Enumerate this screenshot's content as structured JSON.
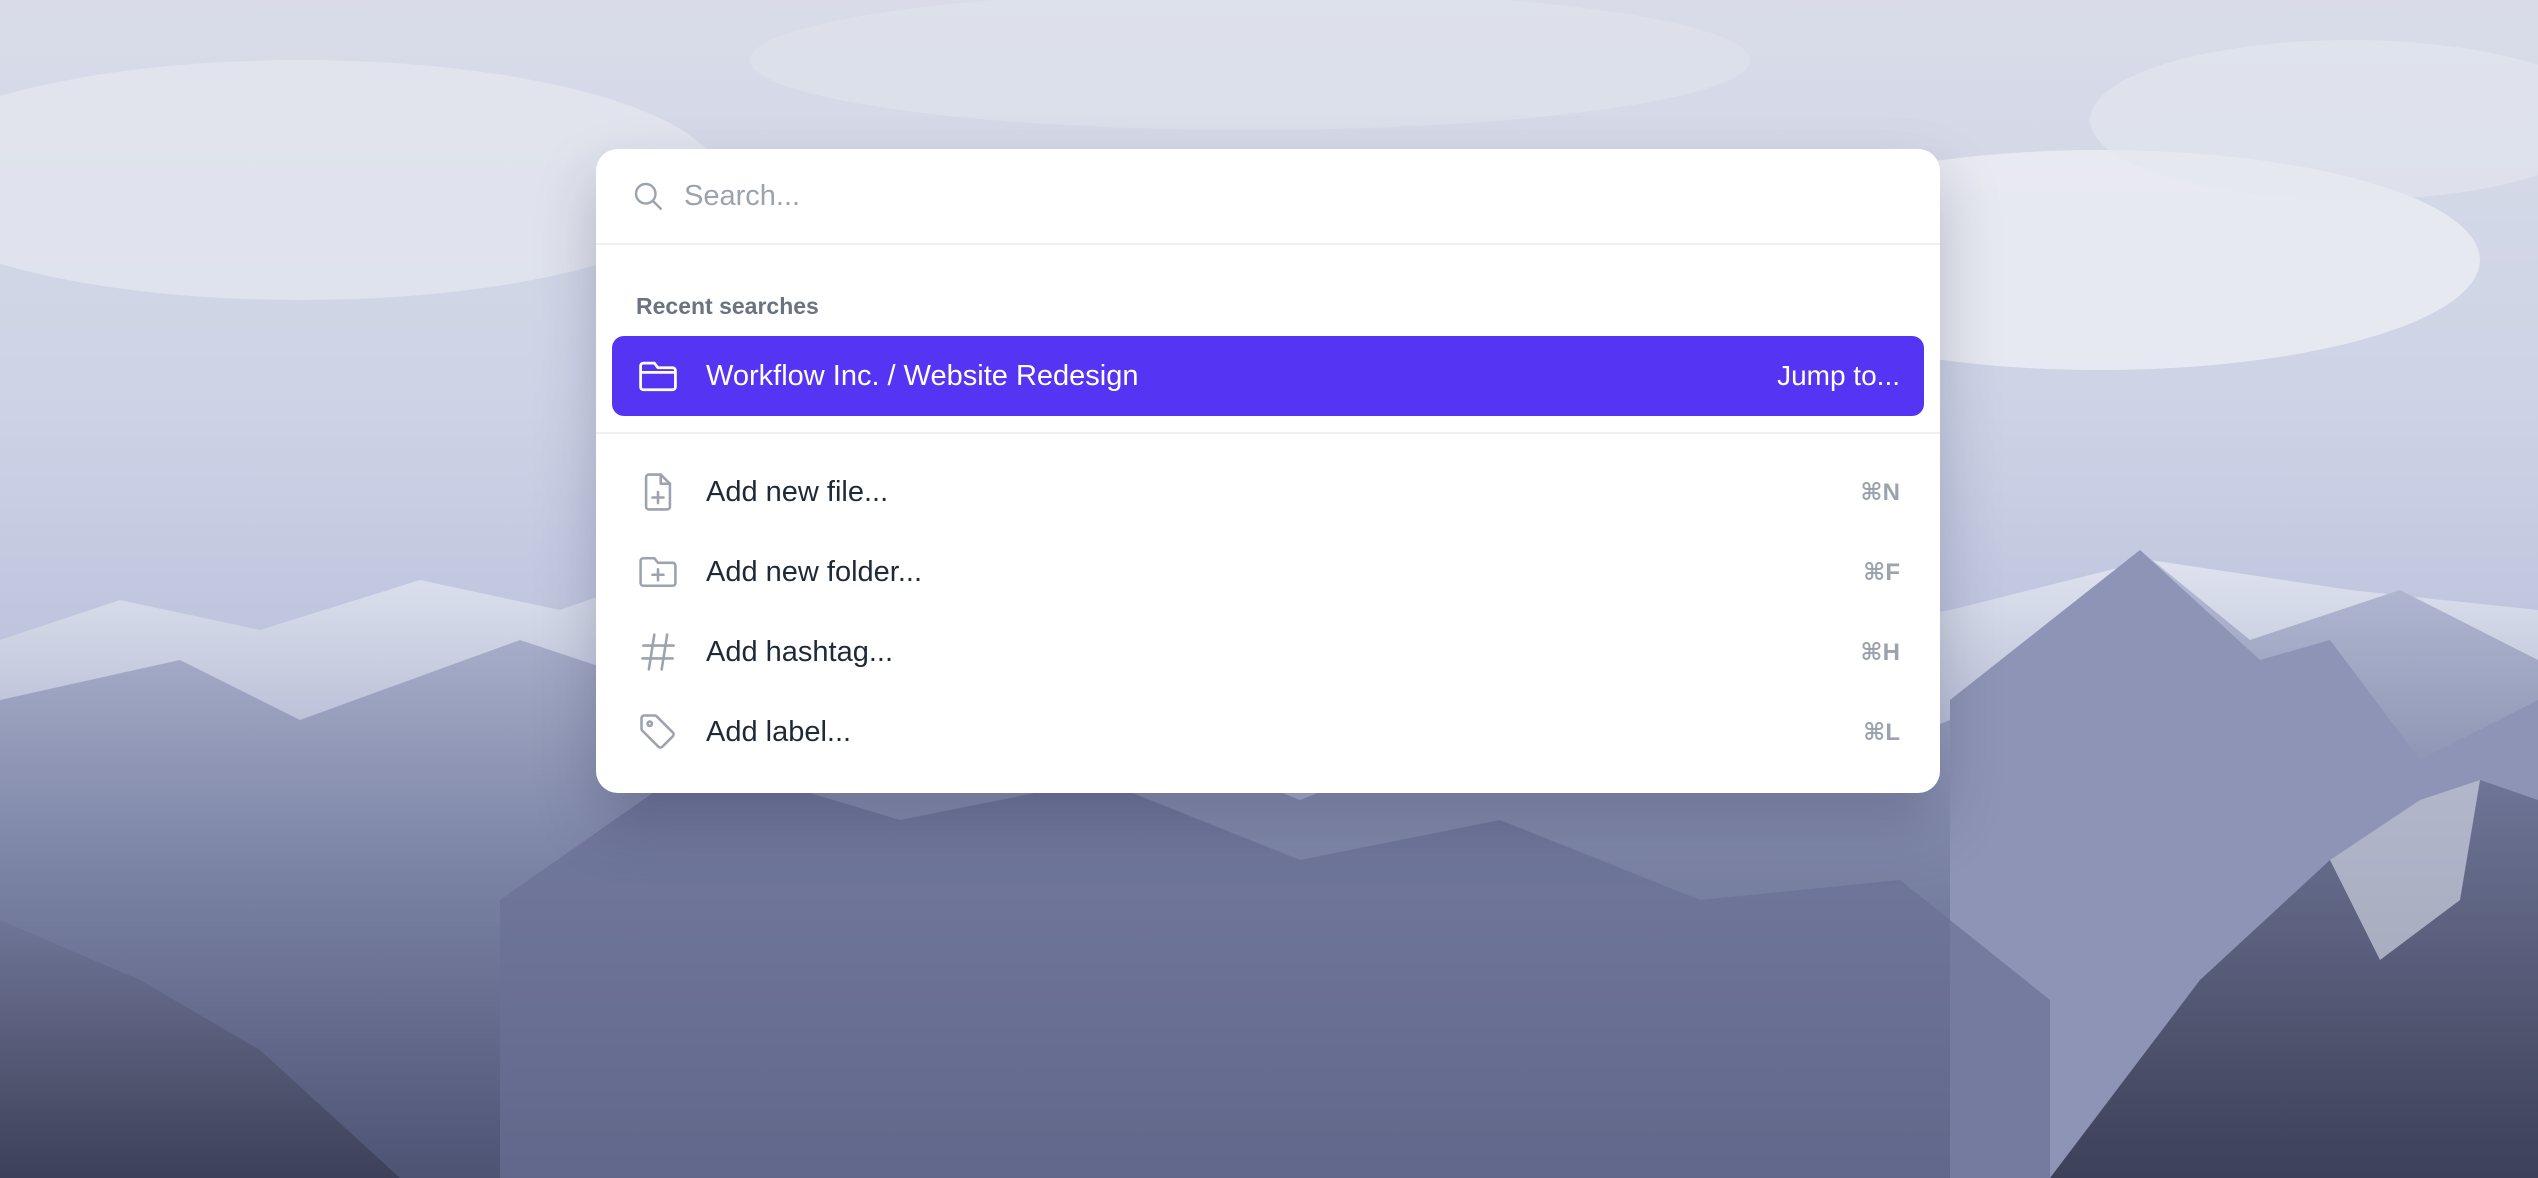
{
  "search": {
    "placeholder": "Search...",
    "value": ""
  },
  "recent": {
    "heading": "Recent searches",
    "items": [
      {
        "icon": "folder-icon",
        "label": "Workflow Inc. / Website Redesign",
        "action": "Jump to..."
      }
    ]
  },
  "actions": [
    {
      "icon": "document-plus-icon",
      "label": "Add new file...",
      "shortcut": "⌘N"
    },
    {
      "icon": "folder-plus-icon",
      "label": "Add new folder...",
      "shortcut": "⌘F"
    },
    {
      "icon": "hashtag-icon",
      "label": "Add hashtag...",
      "shortcut": "⌘H"
    },
    {
      "icon": "tag-icon",
      "label": "Add label...",
      "shortcut": "⌘L"
    }
  ],
  "colors": {
    "accent": "#5534f4",
    "muted_text": "#6b7280",
    "icon": "#9ca3af"
  }
}
